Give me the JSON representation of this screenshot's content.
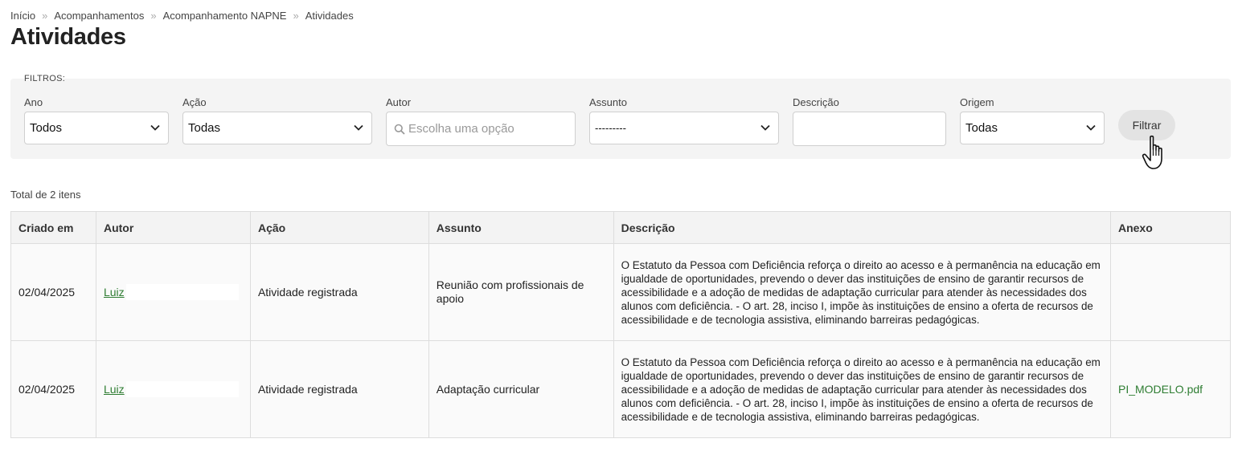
{
  "breadcrumb": {
    "items": [
      "Início",
      "Acompanhamentos",
      "Acompanhamento NAPNE",
      "Atividades"
    ],
    "separator": "»"
  },
  "page": {
    "title": "Atividades"
  },
  "filters": {
    "title": "FILTROS:",
    "ano": {
      "label": "Ano",
      "value": "Todos"
    },
    "acao": {
      "label": "Ação",
      "value": "Todas"
    },
    "autor": {
      "label": "Autor",
      "placeholder": "Escolha uma opção"
    },
    "assunto": {
      "label": "Assunto",
      "value": "---------"
    },
    "descricao": {
      "label": "Descrição",
      "value": ""
    },
    "origem": {
      "label": "Origem",
      "value": "Todas"
    },
    "button_label": "Filtrar"
  },
  "results": {
    "total_label": "Total de 2 itens",
    "columns": [
      "Criado em",
      "Autor",
      "Ação",
      "Assunto",
      "Descrição",
      "Anexo"
    ],
    "rows": [
      {
        "created": "02/04/2025",
        "author": "Luiz",
        "action": "Atividade registrada",
        "subject": "Reunião com profissionais de apoio",
        "description": "O Estatuto da Pessoa com Deficiência reforça o direito ao acesso e à permanência na educação em igualdade de oportunidades, prevendo o dever das instituições de ensino de garantir recursos de acessibilidade e a adoção de medidas de adaptação curricular para atender às necessidades dos alunos com deficiência. - O art. 28, inciso I, impõe às instituições de ensino a oferta de recursos de acessibilidade e de tecnologia assistiva, eliminando barreiras pedagógicas.",
        "attachment": ""
      },
      {
        "created": "02/04/2025",
        "author": "Luiz",
        "action": "Atividade registrada",
        "subject": "Adaptação curricular",
        "description": "O Estatuto da Pessoa com Deficiência reforça o direito ao acesso e à permanência na educação em igualdade de oportunidades, prevendo o dever das instituições de ensino de garantir recursos de acessibilidade e a adoção de medidas de adaptação curricular para atender às necessidades dos alunos com deficiência. - O art. 28, inciso I, impõe às instituições de ensino a oferta de recursos de acessibilidade e de tecnologia assistiva, eliminando barreiras pedagógicas.",
        "attachment": "PI_MODELO.pdf"
      }
    ]
  },
  "icons": {
    "select_arrow": "chevron-down-icon",
    "autor_search": "search-icon",
    "cursor": "hand-pointer-icon"
  },
  "colors": {
    "link_green": "#2e7d32",
    "filter_panel_bg": "#f4f4f4",
    "button_bg": "#e3e3e3"
  }
}
